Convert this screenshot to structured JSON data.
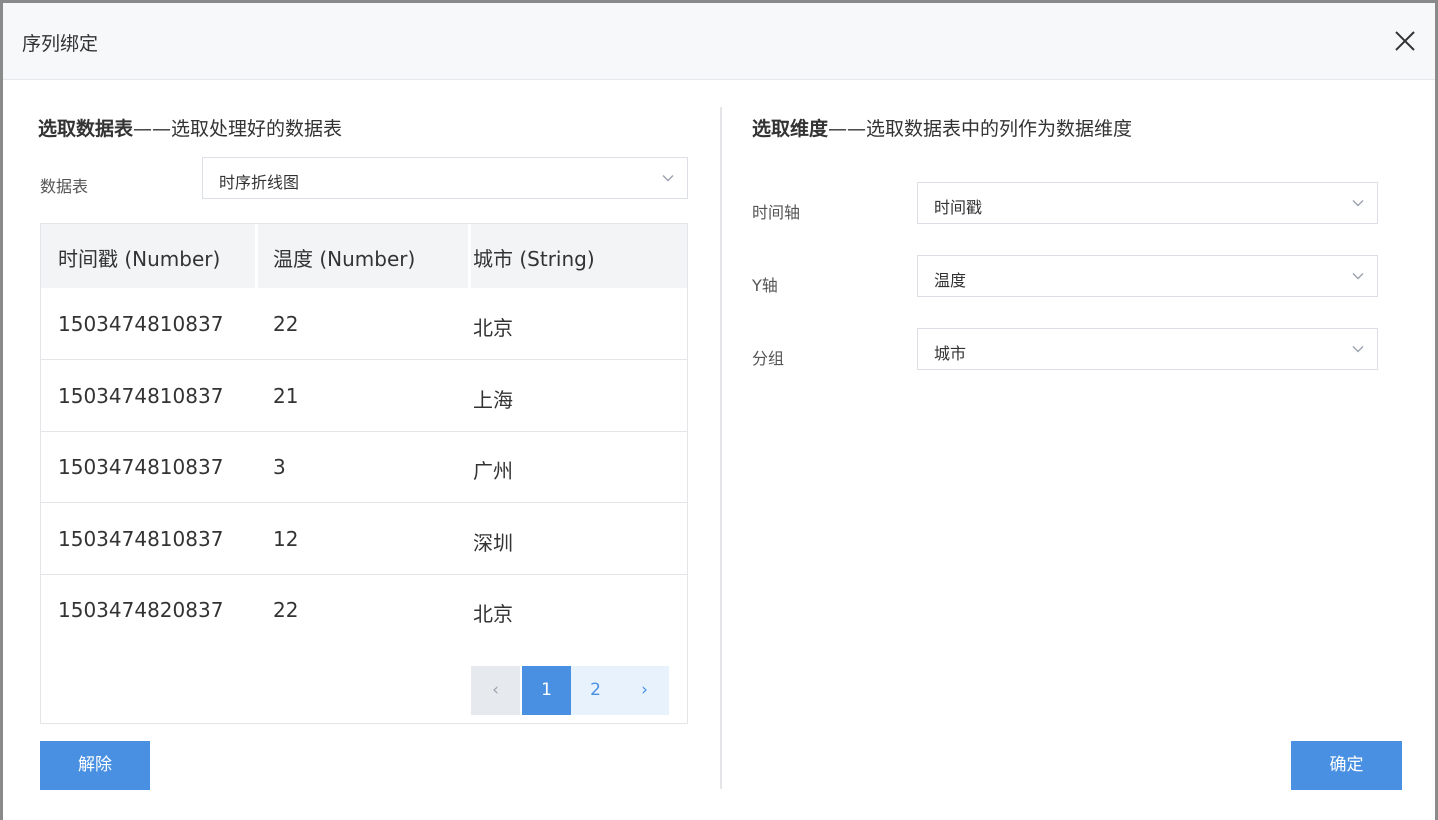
{
  "dialog": {
    "title": "序列绑定",
    "close_icon": "close-icon"
  },
  "left": {
    "title_bold": "选取数据表",
    "title_rest": "——选取处理好的数据表",
    "table_label": "数据表",
    "table_select_value": "时序折线图",
    "columns": [
      "时间戳 (Number)",
      "温度 (Number)",
      "城市 (String)"
    ],
    "rows": [
      [
        "1503474810837",
        "22",
        "北京"
      ],
      [
        "1503474810837",
        "21",
        "上海"
      ],
      [
        "1503474810837",
        "3",
        "广州"
      ],
      [
        "1503474810837",
        "12",
        "深圳"
      ],
      [
        "1503474820837",
        "22",
        "北京"
      ]
    ],
    "pagination": {
      "prev": "‹",
      "pages": [
        "1",
        "2"
      ],
      "current": "1",
      "next": "›"
    },
    "unbind_button": "解除"
  },
  "right": {
    "title_bold": "选取维度",
    "title_rest": "——选取数据表中的列作为数据维度",
    "fields": [
      {
        "label": "时间轴",
        "value": "时间戳"
      },
      {
        "label": "Y轴",
        "value": "温度"
      },
      {
        "label": "分组",
        "value": "城市"
      }
    ],
    "confirm_button": "确定"
  },
  "colors": {
    "primary": "#4a90e2",
    "header_bg": "#f7f8fa",
    "table_header_bg": "#f3f4f6",
    "border": "#e3e5e8"
  }
}
